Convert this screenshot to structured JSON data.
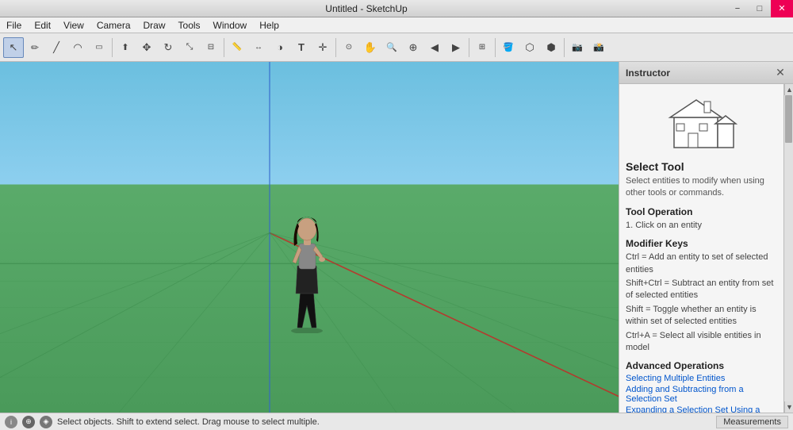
{
  "titlebar": {
    "title": "Untitled - SketchUp",
    "minimize": "−",
    "restore": "□",
    "close": "✕"
  },
  "menubar": {
    "items": [
      "File",
      "Edit",
      "View",
      "Camera",
      "Draw",
      "Tools",
      "Window",
      "Help"
    ]
  },
  "toolbar": {
    "tools": [
      {
        "name": "select",
        "icon": "↖",
        "active": true
      },
      {
        "name": "pencil",
        "icon": "✏"
      },
      {
        "name": "line",
        "icon": "╱"
      },
      {
        "name": "arc",
        "icon": "◠"
      },
      {
        "name": "shape",
        "icon": "⬛"
      },
      {
        "name": "sep1",
        "icon": ""
      },
      {
        "name": "push-pull",
        "icon": "⬆"
      },
      {
        "name": "move",
        "icon": "✥"
      },
      {
        "name": "rotate",
        "icon": "↻"
      },
      {
        "name": "scale",
        "icon": "⤡"
      },
      {
        "name": "offset",
        "icon": "⊟"
      },
      {
        "name": "sep2",
        "icon": ""
      },
      {
        "name": "tape",
        "icon": "📏"
      },
      {
        "name": "dimension",
        "icon": "↔"
      },
      {
        "name": "protractor",
        "icon": "◑"
      },
      {
        "name": "text",
        "icon": "T"
      },
      {
        "name": "axes",
        "icon": "+"
      },
      {
        "name": "sep3",
        "icon": ""
      },
      {
        "name": "orbit",
        "icon": "🔄"
      },
      {
        "name": "pan",
        "icon": "✋"
      },
      {
        "name": "zoom",
        "icon": "🔍"
      },
      {
        "name": "zoom-ext",
        "icon": "⊕"
      },
      {
        "name": "prev-view",
        "icon": "◀"
      },
      {
        "name": "next-view",
        "icon": "▶"
      },
      {
        "name": "sep4",
        "icon": ""
      },
      {
        "name": "section",
        "icon": "⊞"
      },
      {
        "name": "sep5",
        "icon": ""
      },
      {
        "name": "paint",
        "icon": "🪣"
      },
      {
        "name": "component",
        "icon": "⬡"
      },
      {
        "name": "group",
        "icon": "⬢"
      },
      {
        "name": "sep6",
        "icon": ""
      },
      {
        "name": "camera1",
        "icon": "📷"
      },
      {
        "name": "camera2",
        "icon": "📸"
      }
    ]
  },
  "inspector": {
    "title": "Instructor",
    "close_icon": "✕",
    "scroll_up": "▲",
    "scroll_down": "▼",
    "tool_name": "Select Tool",
    "tool_desc": "Select entities to modify when using other tools or commands.",
    "sections": [
      {
        "heading": "Tool Operation",
        "items": [
          "1.   Click on an entity"
        ]
      },
      {
        "heading": "Modifier Keys",
        "items": [
          "Ctrl = Add an entity to set of selected entities",
          "Shift+Ctrl = Subtract an entity from set of selected entities",
          "Shift = Toggle whether an entity is within set of selected entities",
          "Ctrl+A = Select all visible entities in model"
        ]
      },
      {
        "heading": "Advanced Operations",
        "links": [
          "Selecting Multiple Entities",
          "Adding and Subtracting from a Selection Set",
          "Expanding a Selection Set Using a Mouse"
        ]
      }
    ]
  },
  "statusbar": {
    "hint": "Select objects. Shift to extend select. Drag mouse to select multiple.",
    "measurements_label": "Measurements"
  }
}
